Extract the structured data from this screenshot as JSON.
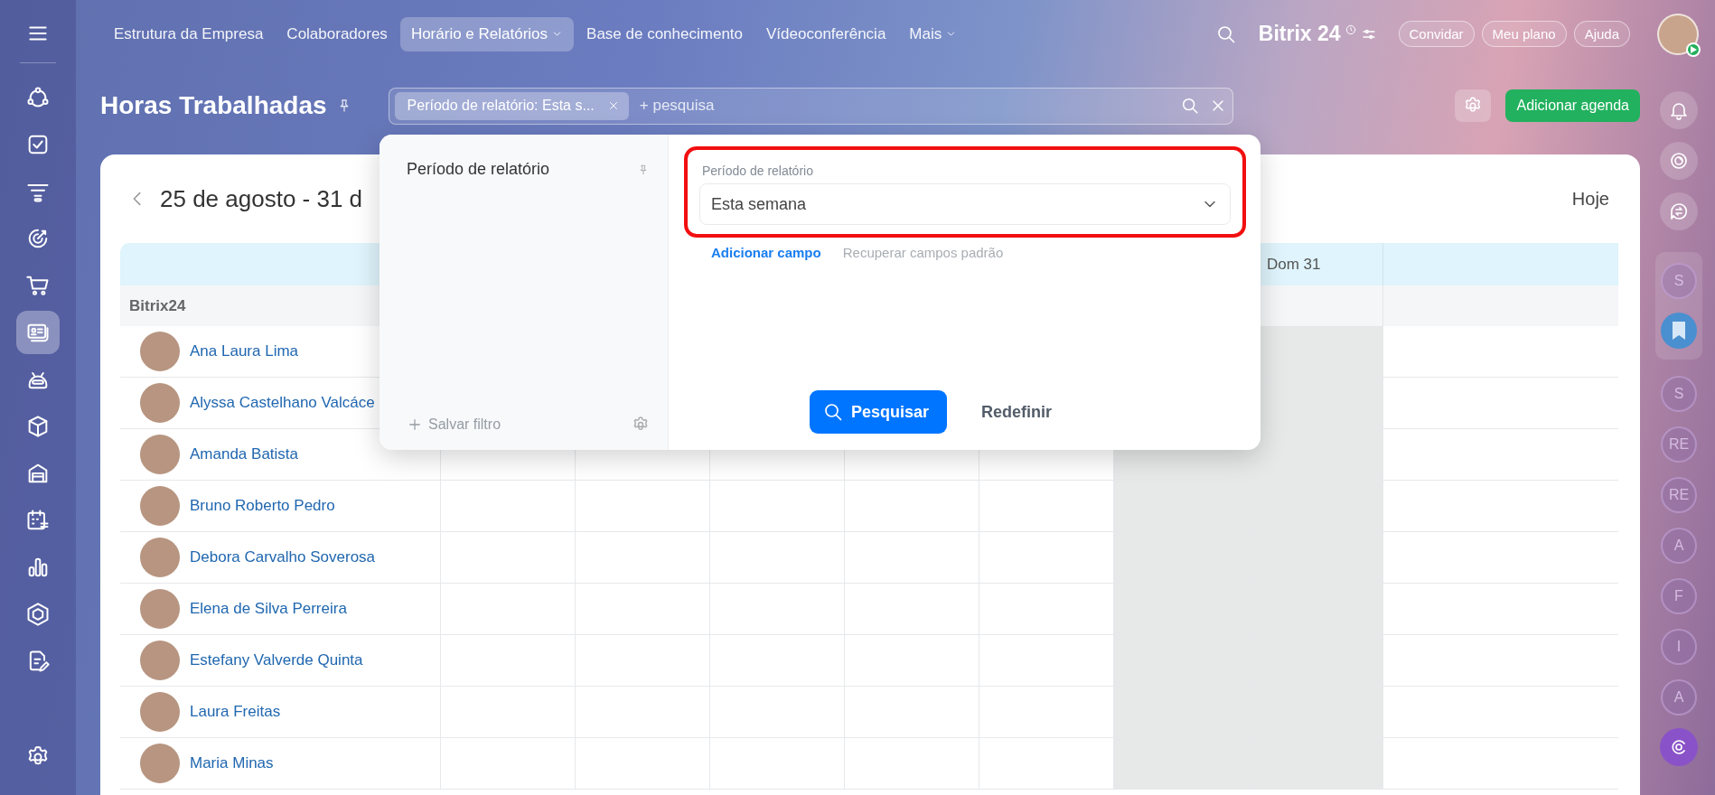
{
  "left_sidebar": {
    "items": [
      {
        "kind": "crm",
        "selected": false
      },
      {
        "kind": "tasks",
        "selected": false
      },
      {
        "kind": "funnel",
        "selected": false
      },
      {
        "kind": "target",
        "selected": false
      },
      {
        "kind": "cart",
        "selected": false
      },
      {
        "kind": "card",
        "selected": true
      },
      {
        "kind": "robot",
        "selected": false
      },
      {
        "kind": "cube",
        "selected": false
      },
      {
        "kind": "garage",
        "selected": false
      },
      {
        "kind": "calendar",
        "selected": false
      },
      {
        "kind": "chart",
        "selected": false
      },
      {
        "kind": "hexagon",
        "selected": false
      },
      {
        "kind": "document",
        "selected": false
      }
    ]
  },
  "top_nav": {
    "items": [
      {
        "label": "Estrutura da Empresa",
        "selected": false,
        "caret": false
      },
      {
        "label": "Colaboradores",
        "selected": false,
        "caret": false
      },
      {
        "label": "Horário e Relatórios",
        "selected": true,
        "caret": true
      },
      {
        "label": "Base de conhecimento",
        "selected": false,
        "caret": false
      },
      {
        "label": "Vídeoconferência",
        "selected": false,
        "caret": false
      },
      {
        "label": "Mais",
        "selected": false,
        "caret": true
      }
    ],
    "logo": {
      "name": "Bitrix",
      "number": "24"
    },
    "buttons": [
      "Convidar",
      "Meu plano",
      "Ajuda"
    ]
  },
  "page": {
    "title": "Horas Trabalhadas",
    "filter_chip": "Período de relatório: Esta s...",
    "search_placeholder": "+ pesquisa",
    "add_button": "Adicionar agenda"
  },
  "calendar": {
    "range": "25 de agosto - 31 d",
    "today_button": "Hoje",
    "columns": [
      {
        "weekend": false
      },
      {
        "weekend": false
      },
      {
        "weekend": false
      },
      {
        "weekend": false
      },
      {
        "weekend": false
      },
      {
        "weekend": true
      },
      {
        "weekend": true,
        "label": "Dom 31"
      },
      {
        "weekend": false
      }
    ],
    "group": "Bitrix24",
    "rows": [
      {
        "name": "Ana Laura Lima"
      },
      {
        "name": "Alyssa Castelhano Valcáce"
      },
      {
        "name": "Amanda Batista"
      },
      {
        "name": "Bruno Roberto Pedro"
      },
      {
        "name": "Debora Carvalho Soverosa"
      },
      {
        "name": "Elena de Silva Perreira"
      },
      {
        "name": "Estefany Valverde Quinta"
      },
      {
        "name": "Laura Freitas"
      },
      {
        "name": "Maria Minas"
      }
    ]
  },
  "filter_popup": {
    "presets": [
      {
        "label": "Período de relatório",
        "selected": false
      }
    ],
    "save_filter": "Salvar filtro",
    "field": {
      "label": "Período de relatório",
      "value": "Esta semana",
      "highlighted": true
    },
    "add_field": "Adicionar campo",
    "restore_fields": "Recuperar campos padrão",
    "search_button": "Pesquisar",
    "reset_button": "Redefinir"
  },
  "right_sidebar": {
    "pinned": [
      {
        "kind": "letter",
        "text": "S"
      },
      {
        "kind": "bookmark"
      }
    ],
    "chats": [
      {
        "text": "S"
      },
      {
        "text": "RE"
      },
      {
        "text": "RE"
      },
      {
        "text": "A"
      },
      {
        "text": "F"
      },
      {
        "text": "I"
      },
      {
        "text": "A"
      }
    ]
  }
}
